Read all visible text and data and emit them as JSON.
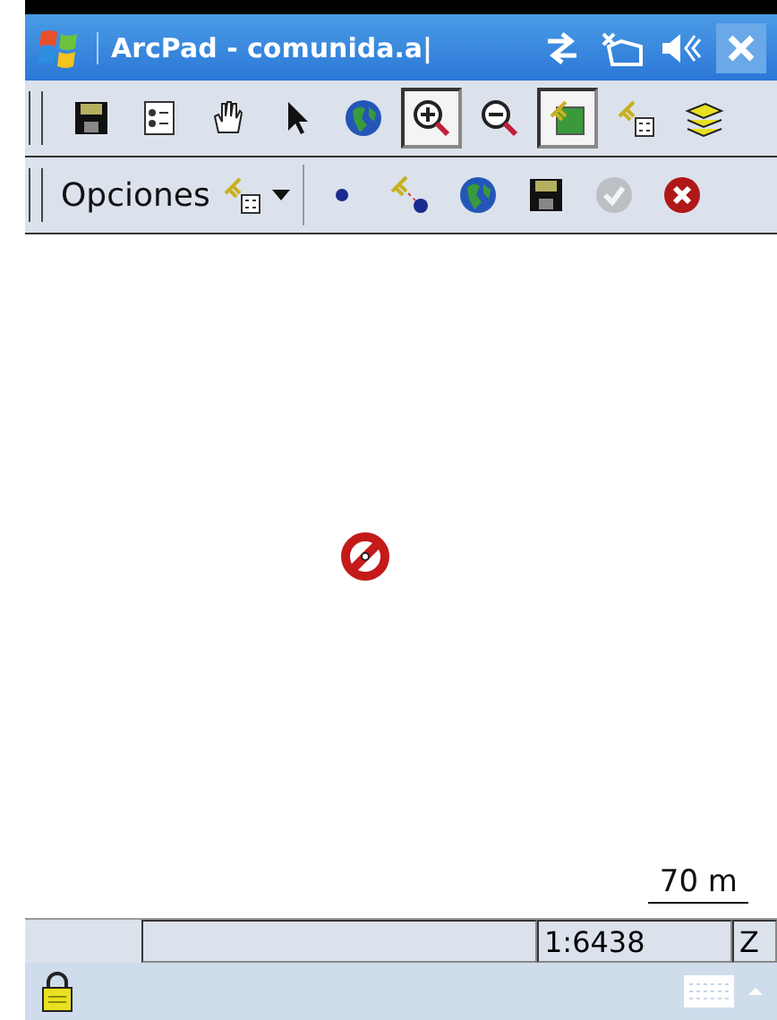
{
  "title_bar": {
    "title": "ArcPad - comunida.a|"
  },
  "toolbar_main": [
    {
      "kind": "save",
      "selected": false
    },
    {
      "kind": "list",
      "selected": false
    },
    {
      "kind": "pan",
      "selected": false
    },
    {
      "kind": "pointer",
      "selected": false
    },
    {
      "kind": "globe",
      "selected": false
    },
    {
      "kind": "zoomin",
      "selected": true
    },
    {
      "kind": "zoomout",
      "selected": false
    },
    {
      "kind": "gpsmap",
      "selected": true
    },
    {
      "kind": "gpslist",
      "selected": false
    },
    {
      "kind": "layers",
      "selected": false
    }
  ],
  "toolbar_options": {
    "label": "Opciones",
    "items": [
      {
        "kind": "dot",
        "disabled": false
      },
      {
        "kind": "gpsdot",
        "disabled": false
      },
      {
        "kind": "globe",
        "disabled": false
      },
      {
        "kind": "save",
        "disabled": false
      },
      {
        "kind": "check",
        "disabled": true
      },
      {
        "kind": "cancel",
        "disabled": false
      }
    ]
  },
  "map": {
    "scale_bar": "70 m"
  },
  "status_bar": {
    "scale": "1:6438",
    "column_3": "Z"
  }
}
